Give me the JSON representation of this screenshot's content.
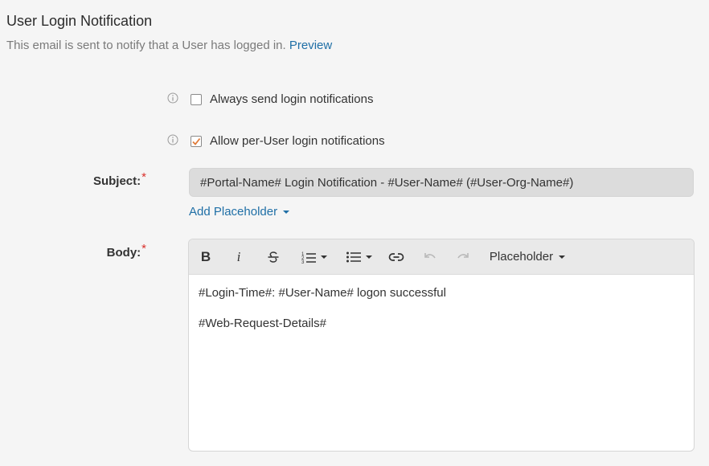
{
  "header": {
    "title": "User Login Notification",
    "description": "This email is sent to notify that a User has logged in.",
    "preview_link": "Preview"
  },
  "options": [
    {
      "label": "Always send login notifications",
      "checked": false
    },
    {
      "label": "Allow per-User login notifications",
      "checked": true
    }
  ],
  "subject": {
    "label": "Subject:",
    "required_mark": "*",
    "value": "#Portal-Name# Login Notification - #User-Name# (#User-Org-Name#)",
    "add_placeholder": "Add Placeholder"
  },
  "body": {
    "label": "Body:",
    "required_mark": "*",
    "toolbar": {
      "bold": "B",
      "italic": "i",
      "placeholder_menu": "Placeholder"
    },
    "lines": [
      "#Login-Time#: #User-Name# logon successful",
      "#Web-Request-Details#"
    ]
  },
  "colors": {
    "link": "#1f6fa6",
    "required": "#d9302c",
    "checkbox_check": "#e07b3a"
  },
  "icons": {
    "info": "info-icon",
    "bold": "bold-icon",
    "italic": "italic-icon",
    "strike": "strikethrough-icon",
    "ordered_list": "ordered-list-icon",
    "bullet_list": "bullet-list-icon",
    "link": "link-icon",
    "undo": "undo-icon",
    "redo": "redo-icon"
  }
}
